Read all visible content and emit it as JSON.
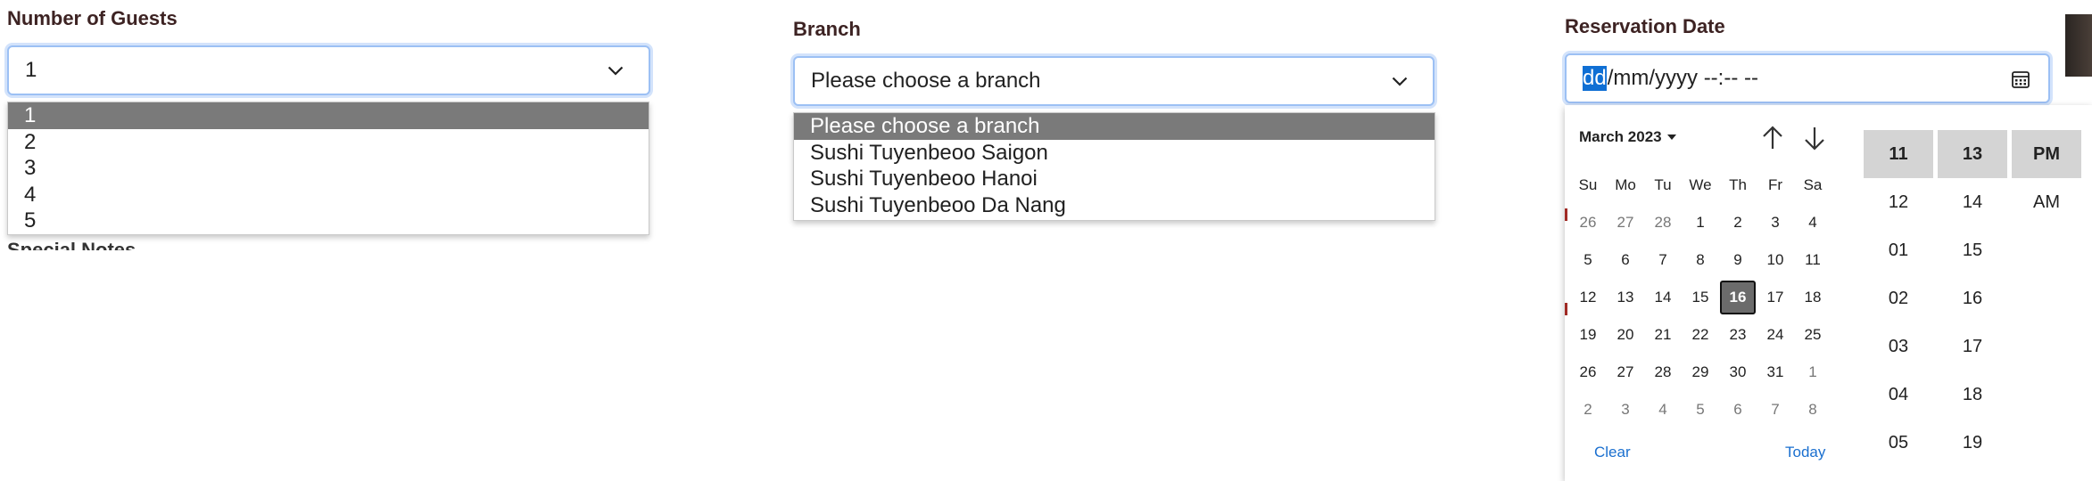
{
  "guests": {
    "label": "Number of Guests",
    "selected": "1",
    "options": [
      "1",
      "2",
      "3",
      "4",
      "5"
    ]
  },
  "branch": {
    "label": "Branch",
    "selected": "Please choose a branch",
    "options": [
      "Please choose a branch",
      "Sushi Tuyenbeoo Saigon",
      "Sushi Tuyenbeoo Hanoi",
      "Sushi Tuyenbeoo Da Nang"
    ]
  },
  "reservation": {
    "label": "Reservation Date",
    "input_active_segment": "dd",
    "input_rest": "/mm/yyyy --:-- --"
  },
  "calendar": {
    "month_label": "March 2023",
    "weekdays": [
      "Su",
      "Mo",
      "Tu",
      "We",
      "Th",
      "Fr",
      "Sa"
    ],
    "weeks": [
      [
        "26",
        "27",
        "28",
        "1",
        "2",
        "3",
        "4"
      ],
      [
        "5",
        "6",
        "7",
        "8",
        "9",
        "10",
        "11"
      ],
      [
        "12",
        "13",
        "14",
        "15",
        "16",
        "17",
        "18"
      ],
      [
        "19",
        "20",
        "21",
        "22",
        "23",
        "24",
        "25"
      ],
      [
        "26",
        "27",
        "28",
        "29",
        "30",
        "31",
        "1"
      ],
      [
        "2",
        "3",
        "4",
        "5",
        "6",
        "7",
        "8"
      ]
    ],
    "today": "16",
    "clear_label": "Clear",
    "today_label": "Today"
  },
  "time": {
    "hours": [
      "11",
      "12",
      "01",
      "02",
      "03",
      "04",
      "05"
    ],
    "minutes": [
      "13",
      "14",
      "15",
      "16",
      "17",
      "18",
      "19"
    ],
    "periods": [
      "PM",
      "AM"
    ],
    "selected_hour": "11",
    "selected_minute": "13",
    "selected_period": "PM"
  },
  "colors": {
    "label": "#3d2323",
    "focus_border": "#9cc0f4",
    "selected_option_bg": "#7a7a7a",
    "link": "#1a6fcf",
    "segment_highlight": "#0f6fd4"
  },
  "icons": [
    "chevron-down-icon",
    "calendar-icon",
    "arrow-up-icon",
    "arrow-down-icon"
  ]
}
